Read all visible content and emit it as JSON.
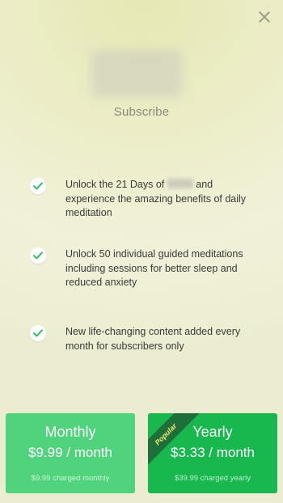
{
  "header": {
    "title": "Subscribe",
    "close_icon": "close-icon"
  },
  "features": [
    {
      "icon": "checkmark-icon",
      "text_before": "Unlock the 21 Days of",
      "text_after": "and experience the amazing benefits of daily meditation"
    },
    {
      "icon": "checkmark-icon",
      "text": "Unlock 50 individual guided meditations including sessions for better sleep and reduced anxiety"
    },
    {
      "icon": "checkmark-icon",
      "text": "New life-changing content added every month for subscribers only"
    }
  ],
  "plans": {
    "monthly": {
      "name": "Monthly",
      "price": "$9.99 / month",
      "note": "$9.99 charged monthly"
    },
    "yearly": {
      "name": "Yearly",
      "price": "$3.33 / month",
      "note": "$39.99 charged yearly",
      "badge": "Popular"
    }
  },
  "colors": {
    "monthly_bg": "#4fd37c",
    "yearly_bg": "#18b84e",
    "check": "#2fbf5f",
    "badge_bg": "#1f6f3a",
    "badge_text": "#f3e96a"
  }
}
